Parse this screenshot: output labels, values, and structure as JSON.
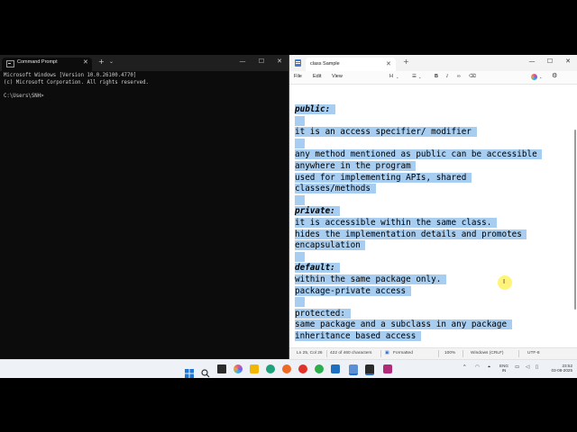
{
  "cmd": {
    "tab_title": "Command Prompt",
    "lines": [
      "Microsoft Windows [Version 10.0.26100.4770]",
      "(c) Microsoft Corporation. All rights reserved.",
      "",
      "C:\\Users\\SNH>"
    ]
  },
  "notepad": {
    "tab_title": "class Sample",
    "menu": [
      "File",
      "Edit",
      "View"
    ],
    "toolbar": {
      "heading": "H",
      "list": "☰",
      "bold": "B",
      "italic": "I",
      "link": "∞",
      "clear": "⌫"
    },
    "lines": [
      {
        "text": "public:",
        "style": "bi"
      },
      {
        "text": "",
        "style": "n"
      },
      {
        "text": "it is an access specifier/ modifier",
        "style": "n"
      },
      {
        "text": "",
        "style": "n"
      },
      {
        "text": "any method mentioned as public can be accessible",
        "style": "n"
      },
      {
        "text": "anywhere in the program",
        "style": "n"
      },
      {
        "text": "used for implementing APIs, shared",
        "style": "n"
      },
      {
        "text": "classes/methods",
        "style": "n"
      },
      {
        "text": "",
        "style": "n"
      },
      {
        "text": "private:",
        "style": "bi"
      },
      {
        "text": "it is accessible within the same class.",
        "style": "n"
      },
      {
        "text": "hides the implementation details and promotes",
        "style": "n"
      },
      {
        "text": "encapsulation",
        "style": "n"
      },
      {
        "text": "",
        "style": "n"
      },
      {
        "text": "default:",
        "style": "bi"
      },
      {
        "text": "within the same package only.",
        "style": "n"
      },
      {
        "text": "package-private access",
        "style": "n"
      },
      {
        "text": "",
        "style": "n"
      },
      {
        "text": "protected:",
        "style": "n"
      },
      {
        "text": "same package and a subclass in any package",
        "style": "n"
      },
      {
        "text": "inheritance based access",
        "style": "n"
      }
    ],
    "status": {
      "position": "Ln 25, Col 26",
      "chars": "422 of 460 characters",
      "format": "Formatted",
      "zoom": "100%",
      "line_ending": "Windows (CRLF)",
      "encoding": "UTF-8"
    }
  },
  "taskbar": {
    "lang_top": "ENG",
    "lang_bottom": "IN",
    "time": "23:52",
    "date": "03-08-2025"
  },
  "colors": {
    "selection": "#a7cdf0",
    "cmd_bg": "#0c0c0c",
    "cursor_highlight": "#fff36a"
  }
}
